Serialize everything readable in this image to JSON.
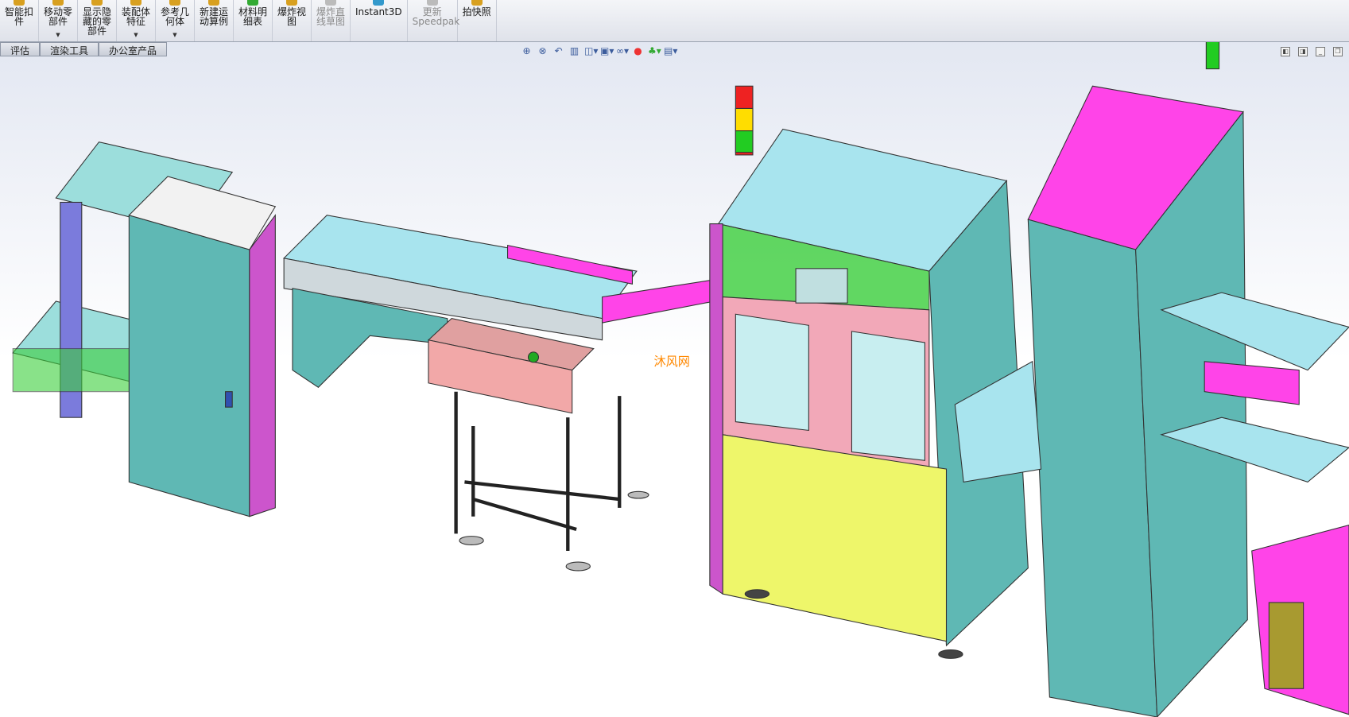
{
  "toolbar": {
    "buttons": [
      {
        "label": "智能扣件",
        "enabled": true,
        "dropdown": false
      },
      {
        "label": "移动零部件",
        "enabled": true,
        "dropdown": true
      },
      {
        "label": "显示隐藏的零部件",
        "enabled": true,
        "dropdown": false
      },
      {
        "label": "装配体特征",
        "enabled": true,
        "dropdown": true
      },
      {
        "label": "参考几何体",
        "enabled": true,
        "dropdown": true
      },
      {
        "label": "新建运动算例",
        "enabled": true,
        "dropdown": false
      },
      {
        "label": "材料明细表",
        "enabled": true,
        "dropdown": false
      },
      {
        "label": "爆炸视图",
        "enabled": true,
        "dropdown": false
      },
      {
        "label": "爆炸直线草图",
        "enabled": false,
        "dropdown": false
      },
      {
        "label": "Instant3D",
        "enabled": true,
        "dropdown": false
      },
      {
        "label": "更新Speedpak",
        "enabled": false,
        "dropdown": false
      },
      {
        "label": "拍快照",
        "enabled": true,
        "dropdown": false
      }
    ]
  },
  "tabs": [
    {
      "label": "评估"
    },
    {
      "label": "渲染工具"
    },
    {
      "label": "办公室产品"
    }
  ],
  "heads_up_toolbar": [
    "zoom-to-fit-icon",
    "zoom-to-area-icon",
    "previous-view-icon",
    "section-view-icon",
    "view-orientation-icon",
    "display-style-icon",
    "hide-show-items-icon",
    "edit-appearance-icon",
    "apply-scene-icon",
    "view-settings-icon"
  ],
  "window_controls": [
    "tile-horizontal",
    "tile-vertical",
    "minimize",
    "restore"
  ],
  "watermark": "沐风网",
  "colors": {
    "cabinet": "#5fb8b4",
    "frame": "#3ccf3c",
    "pink": "#f2a8b8",
    "magenta": "#ff44e8",
    "yellow": "#eef66a",
    "lightcyan": "#a8e4ee"
  }
}
